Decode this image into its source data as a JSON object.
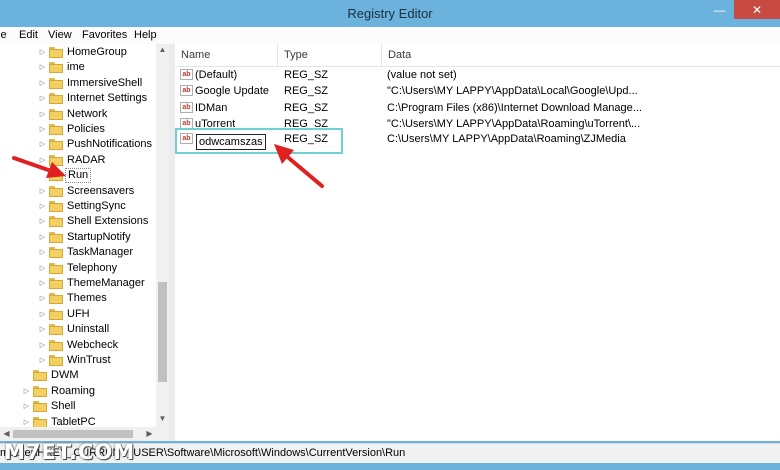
{
  "window": {
    "title": "Registry Editor",
    "minimize_glyph": "—",
    "close_glyph": "✕"
  },
  "menu": [
    "le",
    "Edit",
    "View",
    "Favorites",
    "Help"
  ],
  "tree": {
    "items": [
      {
        "label": "HomeGroup",
        "expander": "▷"
      },
      {
        "label": "ime",
        "expander": "▷"
      },
      {
        "label": "ImmersiveShell",
        "expander": "▷"
      },
      {
        "label": "Internet Settings",
        "expander": "▷"
      },
      {
        "label": "Network",
        "expander": "▷"
      },
      {
        "label": "Policies",
        "expander": "▷"
      },
      {
        "label": "PushNotifications",
        "expander": "▷"
      },
      {
        "label": "RADAR",
        "expander": "▷"
      },
      {
        "label": "Run",
        "expander": ""
      },
      {
        "label": "Screensavers",
        "expander": "▷"
      },
      {
        "label": "SettingSync",
        "expander": "▷"
      },
      {
        "label": "Shell Extensions",
        "expander": "▷"
      },
      {
        "label": "StartupNotify",
        "expander": "▷"
      },
      {
        "label": "TaskManager",
        "expander": "▷"
      },
      {
        "label": "Telephony",
        "expander": "▷"
      },
      {
        "label": "ThemeManager",
        "expander": "▷"
      },
      {
        "label": "Themes",
        "expander": "▷"
      },
      {
        "label": "UFH",
        "expander": "▷"
      },
      {
        "label": "Uninstall",
        "expander": "▷"
      },
      {
        "label": "Webcheck",
        "expander": "▷"
      },
      {
        "label": "WinTrust",
        "expander": "▷"
      },
      {
        "label": "DWM",
        "expander": ""
      },
      {
        "label": "Roaming",
        "expander": "▷"
      },
      {
        "label": "Shell",
        "expander": "▷"
      },
      {
        "label": "TabletPC",
        "expander": "▷"
      }
    ]
  },
  "scroll": {
    "up": "▲",
    "down": "▼",
    "left": "◀",
    "right": "▶"
  },
  "list": {
    "headers": {
      "name": "Name",
      "type": "Type",
      "data": "Data"
    },
    "icon_text": "ab",
    "rows": [
      {
        "name": "(Default)",
        "type": "REG_SZ",
        "data": "(value not set)"
      },
      {
        "name": "Google Update",
        "type": "REG_SZ",
        "data": "\"C:\\Users\\MY LAPPY\\AppData\\Local\\Google\\Upd..."
      },
      {
        "name": "IDMan",
        "type": "REG_SZ",
        "data": "C:\\Program Files (x86)\\Internet Download Manage..."
      },
      {
        "name": "uTorrent",
        "type": "REG_SZ",
        "data": "\"C:\\Users\\MY LAPPY\\AppData\\Roaming\\uTorrent\\..."
      }
    ],
    "edit_row": {
      "name": "odwcamszas",
      "type": "REG_SZ",
      "data": "C:\\Users\\MY LAPPY\\AppData\\Roaming\\ZJMedia"
    }
  },
  "status": {
    "path": "mputer\\HKEY_CURRENT_USER\\Software\\Microsoft\\Windows\\CurrentVersion\\Run"
  },
  "watermark": "M7ET.COM",
  "colors": {
    "titlebar": "#6bb2dc",
    "arrow": "#e02020",
    "highlight": "#6fd1d1"
  }
}
